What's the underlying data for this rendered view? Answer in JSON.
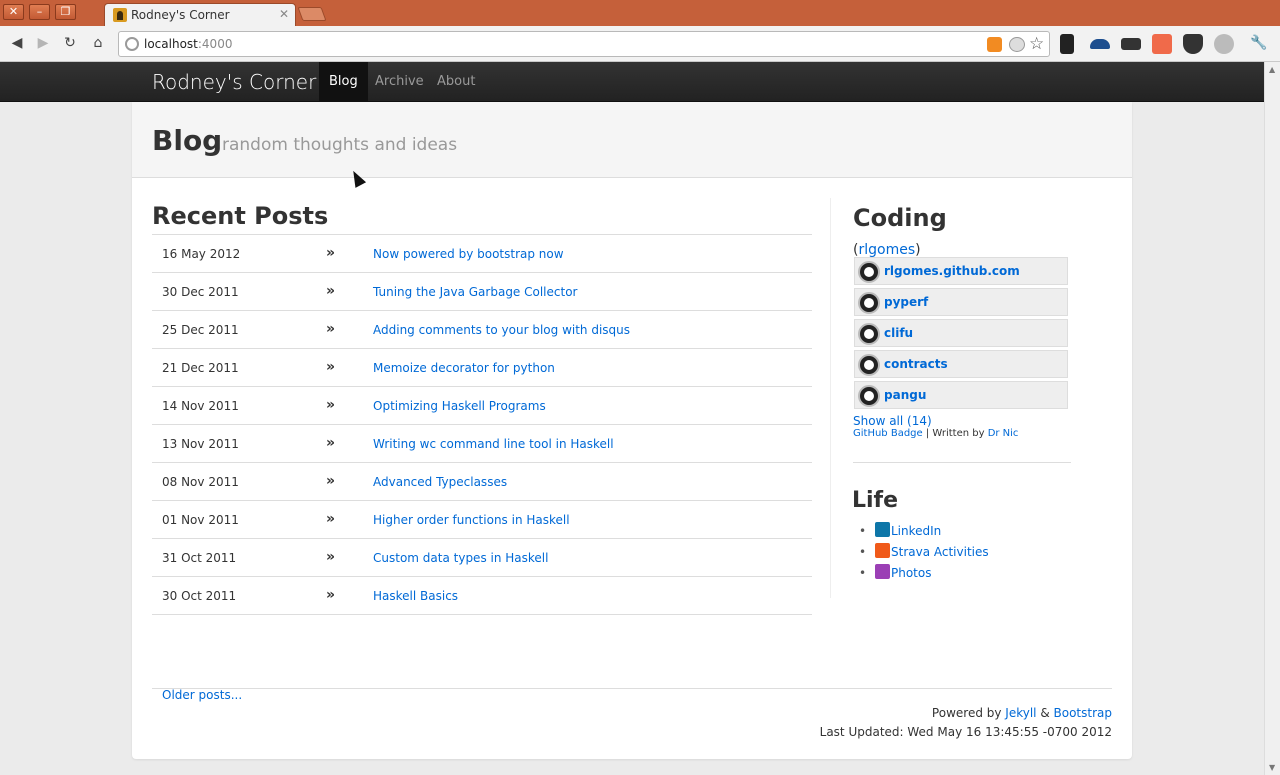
{
  "browser": {
    "tab_title": "Rodney's Corner",
    "url_host": "localhost",
    "url_port": ":4000"
  },
  "nav": {
    "brand": "Rodney's Corner",
    "links": [
      "Blog",
      "Archive",
      "About"
    ],
    "active": "Blog"
  },
  "hero": {
    "title": "Blog",
    "subtitle": "random thoughts and ideas"
  },
  "recent_posts": {
    "title": "Recent Posts",
    "separator": "»",
    "posts": [
      {
        "date": "16 May 2012",
        "title": "Now powered by bootstrap now"
      },
      {
        "date": "30 Dec 2011",
        "title": "Tuning the Java Garbage Collector"
      },
      {
        "date": "25 Dec 2011",
        "title": "Adding comments to your blog with disqus"
      },
      {
        "date": "21 Dec 2011",
        "title": "Memoize decorator for python"
      },
      {
        "date": "14 Nov 2011",
        "title": "Optimizing Haskell Programs"
      },
      {
        "date": "13 Nov 2011",
        "title": "Writing wc command line tool in Haskell"
      },
      {
        "date": "08 Nov 2011",
        "title": "Advanced Typeclasses"
      },
      {
        "date": "01 Nov 2011",
        "title": "Higher order functions in Haskell"
      },
      {
        "date": "31 Oct 2011",
        "title": "Custom data types in Haskell"
      },
      {
        "date": "30 Oct 2011",
        "title": "Haskell Basics"
      }
    ],
    "older_link": "Older posts..."
  },
  "sidebar": {
    "coding_title": "Coding",
    "github_user_prefix": "(",
    "github_user": "rlgomes",
    "github_user_suffix": ")",
    "repos": [
      "rlgomes.github.com",
      "pyperf",
      "clifu",
      "contracts",
      "pangu"
    ],
    "show_all": "Show all (14)",
    "badge_link": "GitHub Badge",
    "badge_sep": " | Written by ",
    "badge_author": "Dr Nic",
    "life_title": "Life",
    "life_links": [
      {
        "label": "LinkedIn",
        "icon": "linkedin-icon",
        "color": "#0e76a8"
      },
      {
        "label": "Strava Activities",
        "icon": "strava-icon",
        "color": "#f05a1a"
      },
      {
        "label": "Photos",
        "icon": "picasa-icon",
        "color": "#9b3fb5"
      }
    ]
  },
  "footer": {
    "powered_prefix": "Powered by ",
    "jekyll": "Jekyll",
    "amp": " & ",
    "bootstrap": "Bootstrap",
    "last_updated": "Last Updated: Wed May 16 13:45:55 -0700 2012"
  },
  "colors": {
    "link": "#0069d6",
    "navbar": "#222222",
    "titlebar": "#c5603a"
  }
}
